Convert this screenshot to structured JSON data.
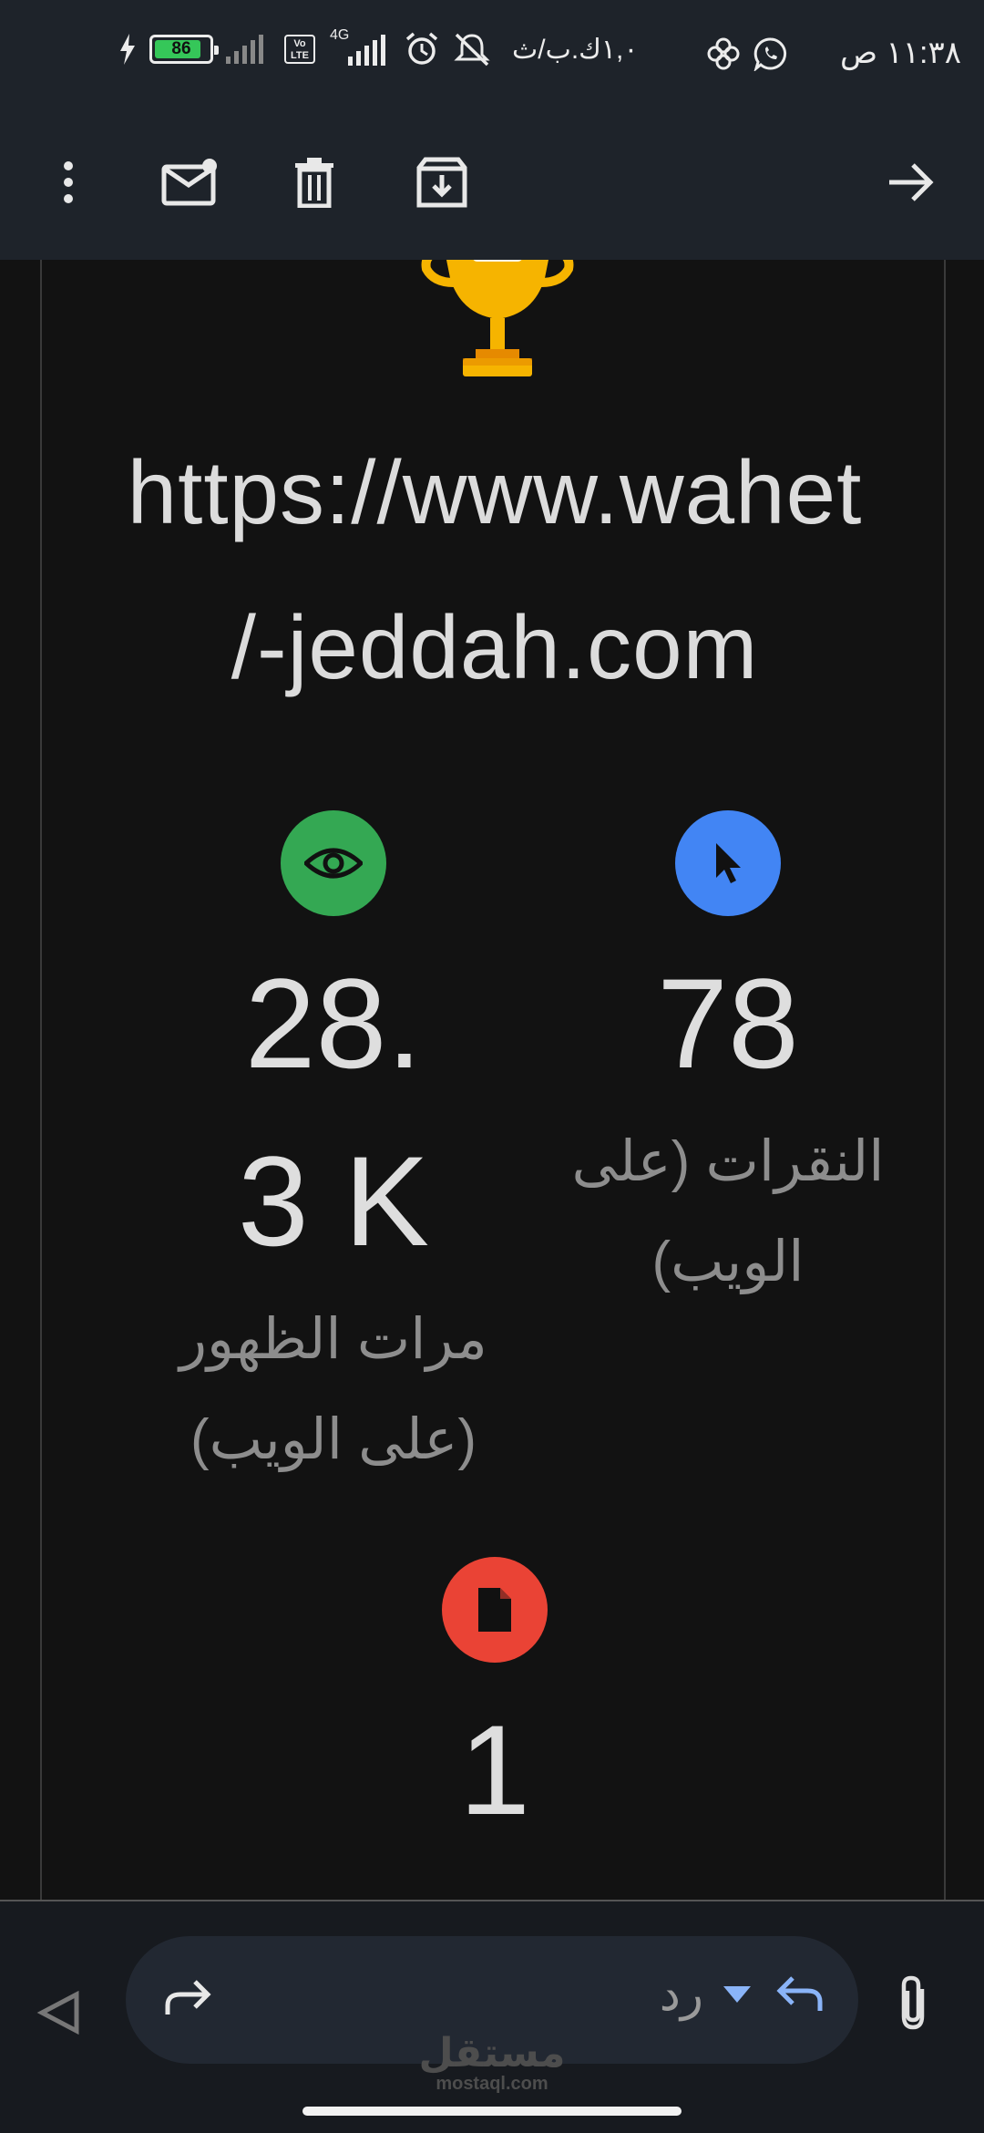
{
  "status_bar": {
    "time": "١١:٣٨ ص",
    "network_speed": "١,٠ك.ب/ث",
    "battery_level": "86",
    "battery_fraction": 0.86,
    "network_type": "4G",
    "volte": "Vo LTE",
    "app_icons": [
      "whatsapp-icon",
      "pinwheel-icon"
    ],
    "status_icons": [
      "silent-icon",
      "alarm-icon",
      "signal-icon",
      "signal-icon",
      "charging-icon"
    ]
  },
  "toolbar": {
    "icons": [
      "more-vert-icon",
      "mark-unread-icon",
      "delete-icon",
      "archive-icon",
      "forward-arrow-icon"
    ]
  },
  "email": {
    "url_line1": "https://www.wahet",
    "url_line2": "/-jeddah.com",
    "stats": [
      {
        "icon": "eye-icon",
        "color": "#34a853",
        "value": "28.3 K",
        "label": "مرات الظهور (على الويب)"
      },
      {
        "icon": "cursor-icon",
        "color": "#4285f4",
        "value": "78",
        "label": "النقرات (على الويب)"
      },
      {
        "icon": "document-icon",
        "color": "#ea4335",
        "value": "1",
        "label": ""
      }
    ]
  },
  "bottom_bar": {
    "reply_label": "رد",
    "icons": [
      "back-triangle-icon",
      "forward-reply-icon",
      "dropdown-icon",
      "reply-icon",
      "attachment-icon"
    ],
    "accent": "#8ab4f8"
  },
  "watermark": {
    "arabic": "مستقل",
    "latin": "mostaql.com"
  }
}
